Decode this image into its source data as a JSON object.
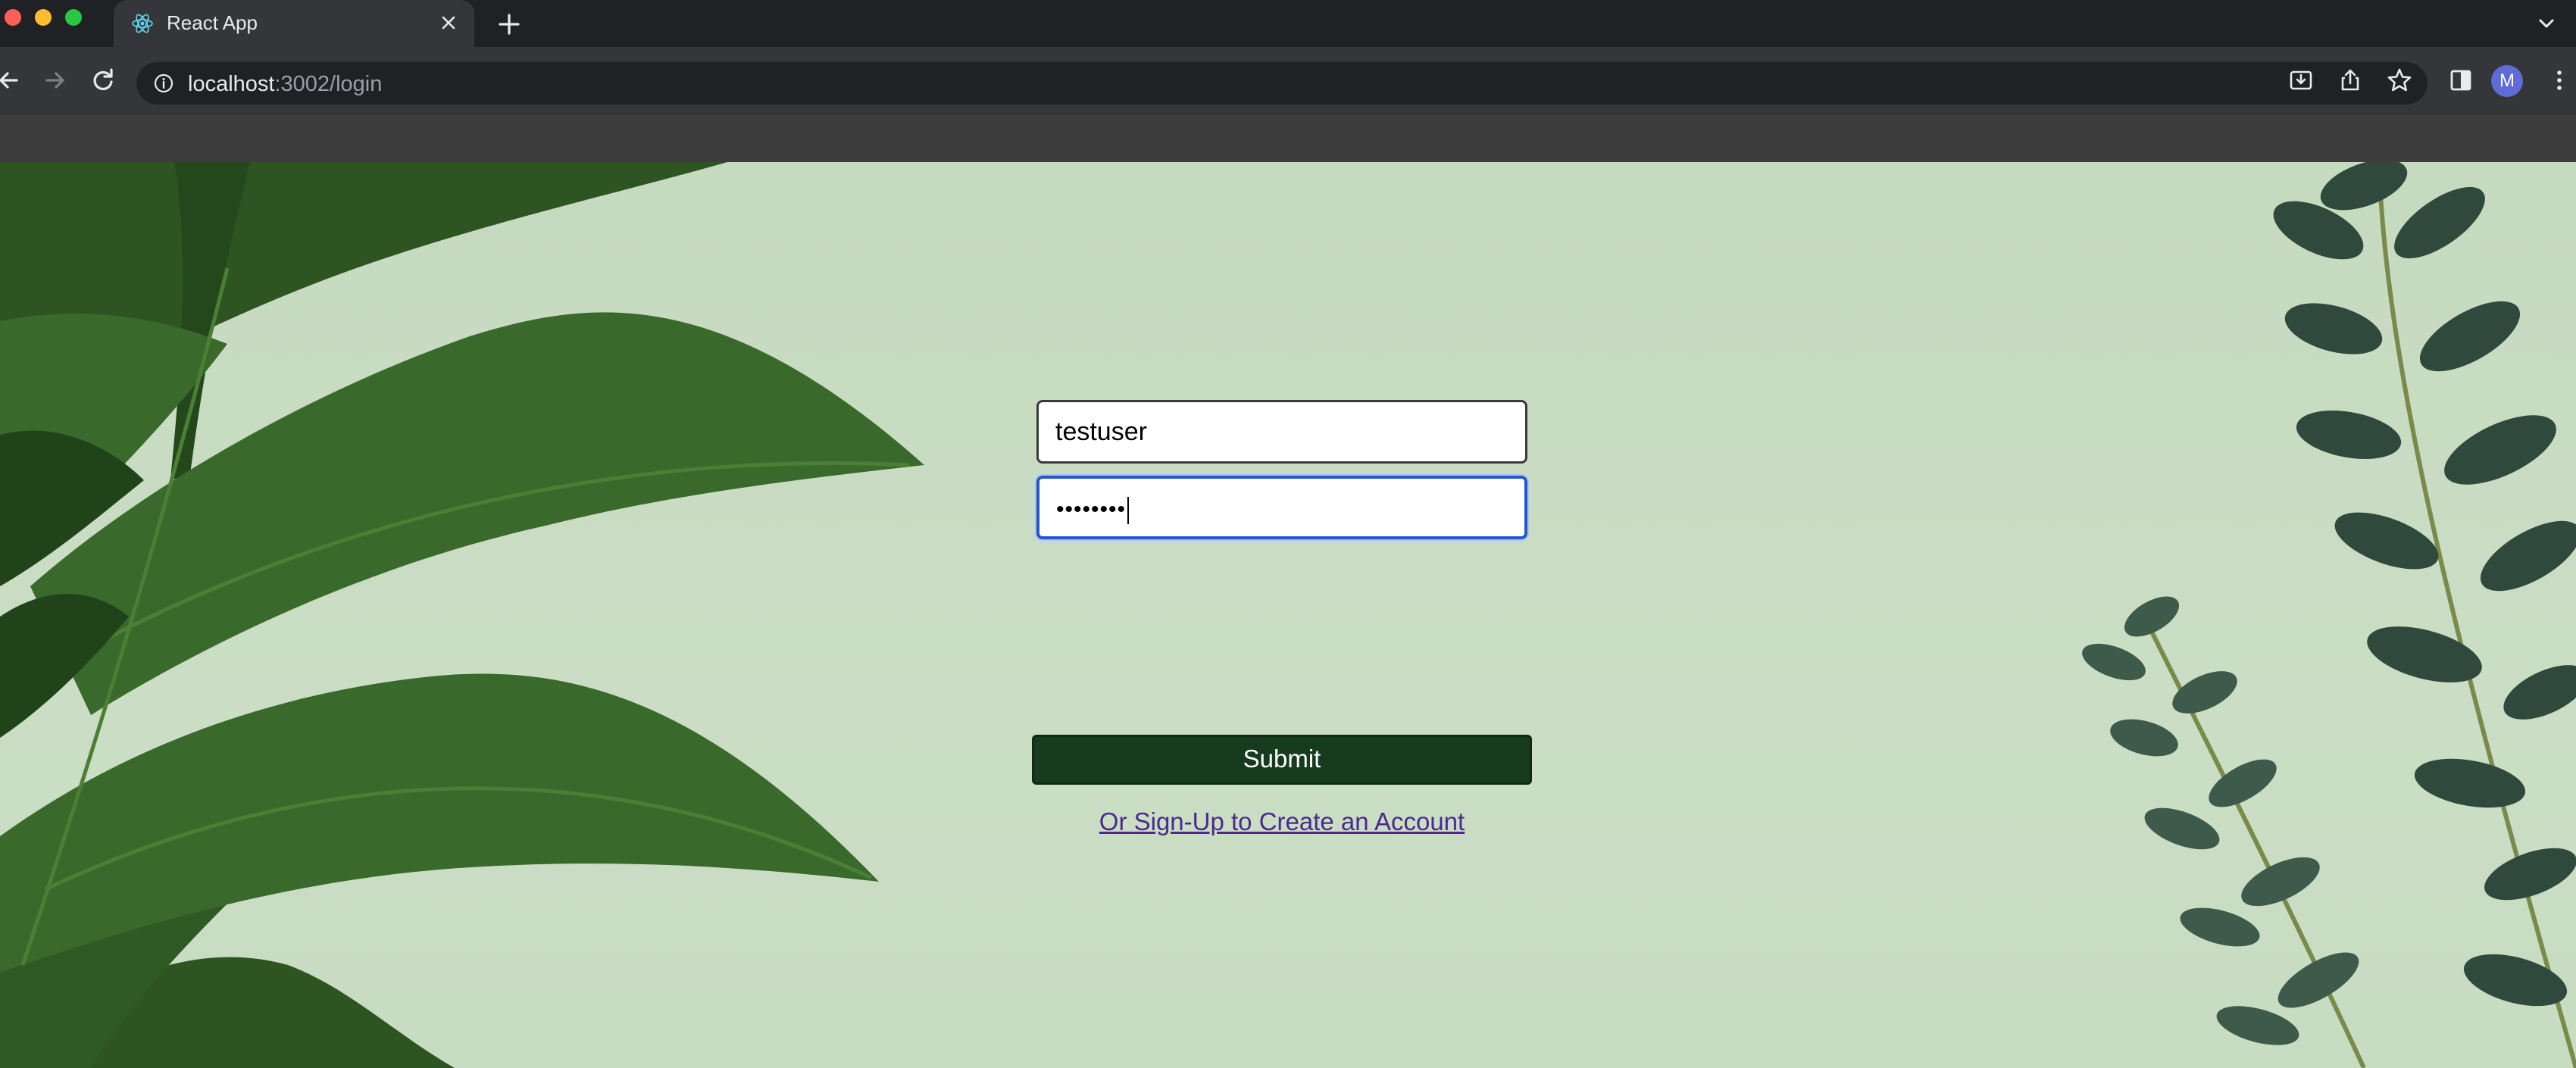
{
  "browser": {
    "tab": {
      "title": "React App",
      "favicon": "react-logo-icon",
      "close_icon": "close-icon"
    },
    "new_tab_icon": "plus-icon",
    "address_bar": {
      "host": "localhost",
      "path": ":3002/login",
      "security_icon": "info-icon"
    },
    "toolbar_icons": [
      "back-arrow-icon",
      "forward-arrow-icon",
      "reload-icon",
      "install-app-icon",
      "share-icon",
      "bookmark-star-icon",
      "side-panel-icon",
      "kebab-menu-icon"
    ],
    "profile_initial": "M",
    "profile_color": "#5f6bd6"
  },
  "login": {
    "username_value": "testuser",
    "password_masked": "••••••••",
    "submit_label": "Submit",
    "signup_link": "Or Sign-Up to Create an Account"
  },
  "colors": {
    "page_background": "#c9dcc3",
    "submit_background": "#173b1e",
    "focus_border": "#2458c6",
    "link": "#4a2a8c"
  }
}
